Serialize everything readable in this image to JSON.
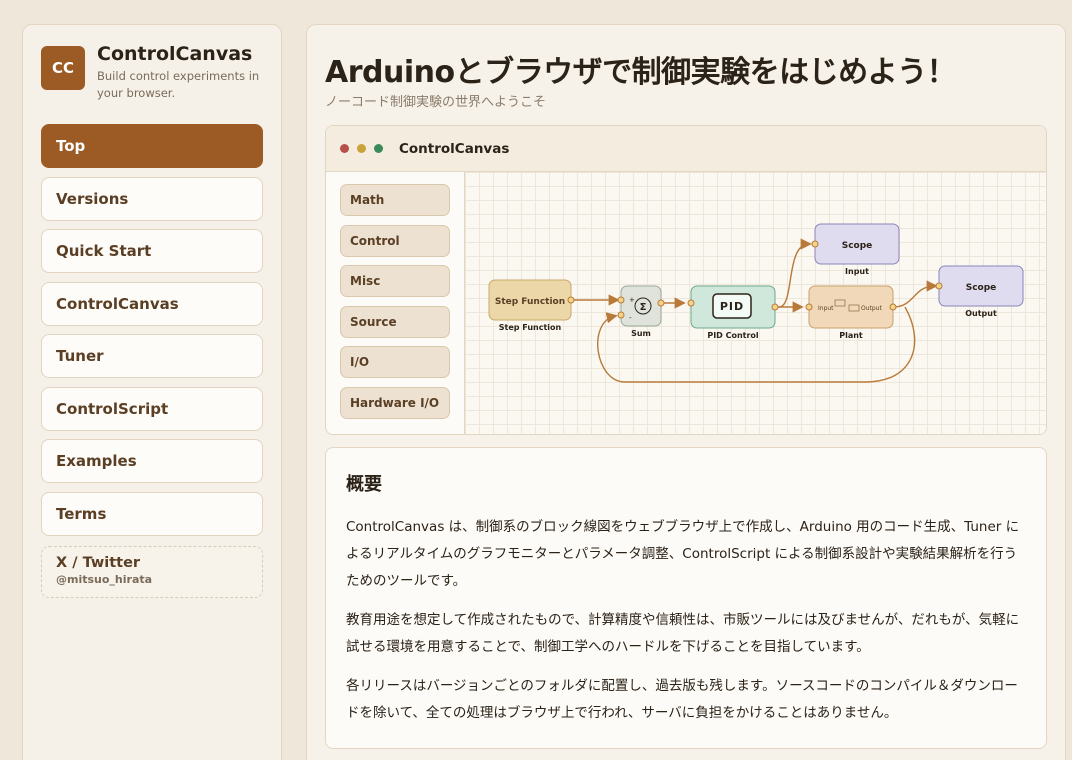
{
  "sidebar": {
    "brand": {
      "logo": "CC",
      "title": "ControlCanvas",
      "subtitle": "Build control experiments in your browser."
    },
    "nav": [
      {
        "label": "Top",
        "active": true
      },
      {
        "label": "Versions",
        "active": false
      },
      {
        "label": "Quick Start",
        "active": false
      },
      {
        "label": "ControlCanvas",
        "active": false
      },
      {
        "label": "Tuner",
        "active": false
      },
      {
        "label": "ControlScript",
        "active": false
      },
      {
        "label": "Examples",
        "active": false
      },
      {
        "label": "Terms",
        "active": false
      }
    ],
    "social": {
      "title": "X / Twitter",
      "handle": "@mitsuo_hirata"
    }
  },
  "main": {
    "title": "Arduinoとブラウザで制御実験をはじめよう！",
    "subtitle": "ノーコード制御実験の世界へようこそ",
    "app_window": {
      "title": "ControlCanvas",
      "window_dots": [
        "#b8504a",
        "#c9a23a",
        "#3a8a5a"
      ],
      "palette": [
        "Math",
        "Control",
        "Misc",
        "Source",
        "I/O",
        "Hardware I/O"
      ],
      "diagram": {
        "step": {
          "label": "Step Function",
          "caption": "Step Function"
        },
        "sum": {
          "symbol": "Σ",
          "plus": "+",
          "minus": "-",
          "caption": "Sum"
        },
        "pid": {
          "label": "PID",
          "caption": "PID Control"
        },
        "plant": {
          "in": "Input",
          "out": "Output",
          "caption": "Plant"
        },
        "scope_top": {
          "label": "Scope",
          "caption": "Input"
        },
        "scope_right": {
          "label": "Scope",
          "caption": "Output"
        }
      }
    },
    "overview": {
      "heading": "概要",
      "paragraphs": [
        "ControlCanvas は、制御系のブロック線図をウェブブラウザ上で作成し、Arduino 用のコード生成、Tuner によるリアルタイムのグラフモニターとパラメータ調整、ControlScript による制御系設計や実験結果解析を行うためのツールです。",
        "教育用途を想定して作成されたもので、計算精度や信頼性は、市販ツールには及びませんが、だれもが、気軽に試せる環境を用意することで、制御工学へのハードルを下げることを目指しています。",
        "各リリースはバージョンごとのフォルダに配置し、過去版も残します。ソースコードのコンパイル＆ダウンロードを除いて、全ての処理はブラウザ上で行われ、サーバに負担をかけることはありません。"
      ]
    }
  },
  "colors": {
    "accent": "#9c5a25",
    "step_fill": "#ecd7a8",
    "pid_fill": "#d0e8dc",
    "plant_fill": "#f0d8b8",
    "scope_fill": "#e0dcf0",
    "wire": "#b87a3a"
  }
}
